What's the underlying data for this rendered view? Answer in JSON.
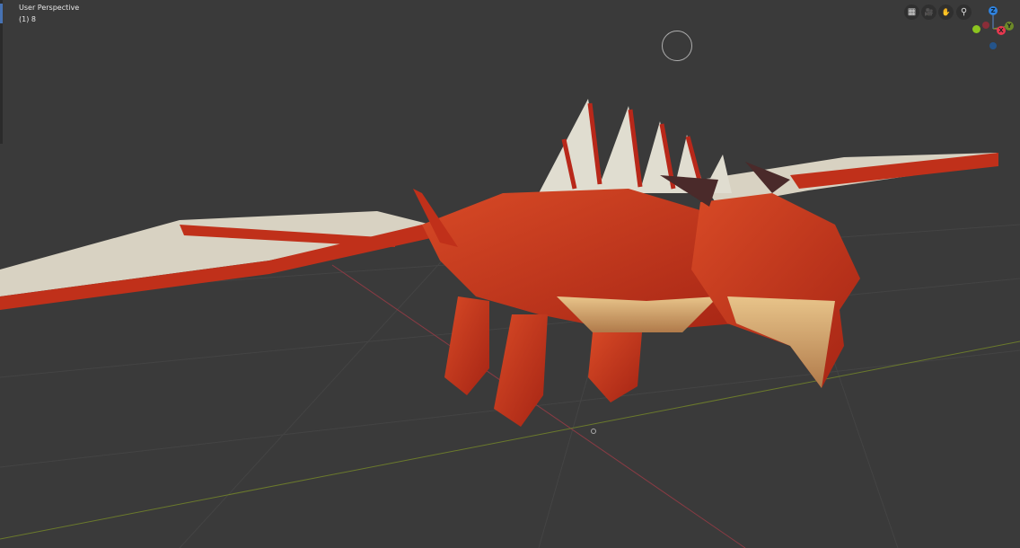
{
  "viewport": {
    "view_name": "User Perspective",
    "collection_info": "(1) 8",
    "nav_buttons": [
      {
        "name": "toggle-grid",
        "icon": "grid-icon",
        "glyph": "▦"
      },
      {
        "name": "camera-view",
        "icon": "camera-icon",
        "glyph": "🎥"
      },
      {
        "name": "pan-view",
        "icon": "hand-icon",
        "glyph": "✋"
      },
      {
        "name": "zoom-view",
        "icon": "magnifier-icon",
        "glyph": "⚲"
      }
    ],
    "gizmo": {
      "z": "Z",
      "x": "X",
      "y": "Y"
    },
    "colors": {
      "background": "#3a3a3a",
      "x_axis": "#e8384f",
      "y_axis": "#8cc41f",
      "z_axis": "#2f83e0",
      "dragon_body": "#c8361c"
    }
  }
}
